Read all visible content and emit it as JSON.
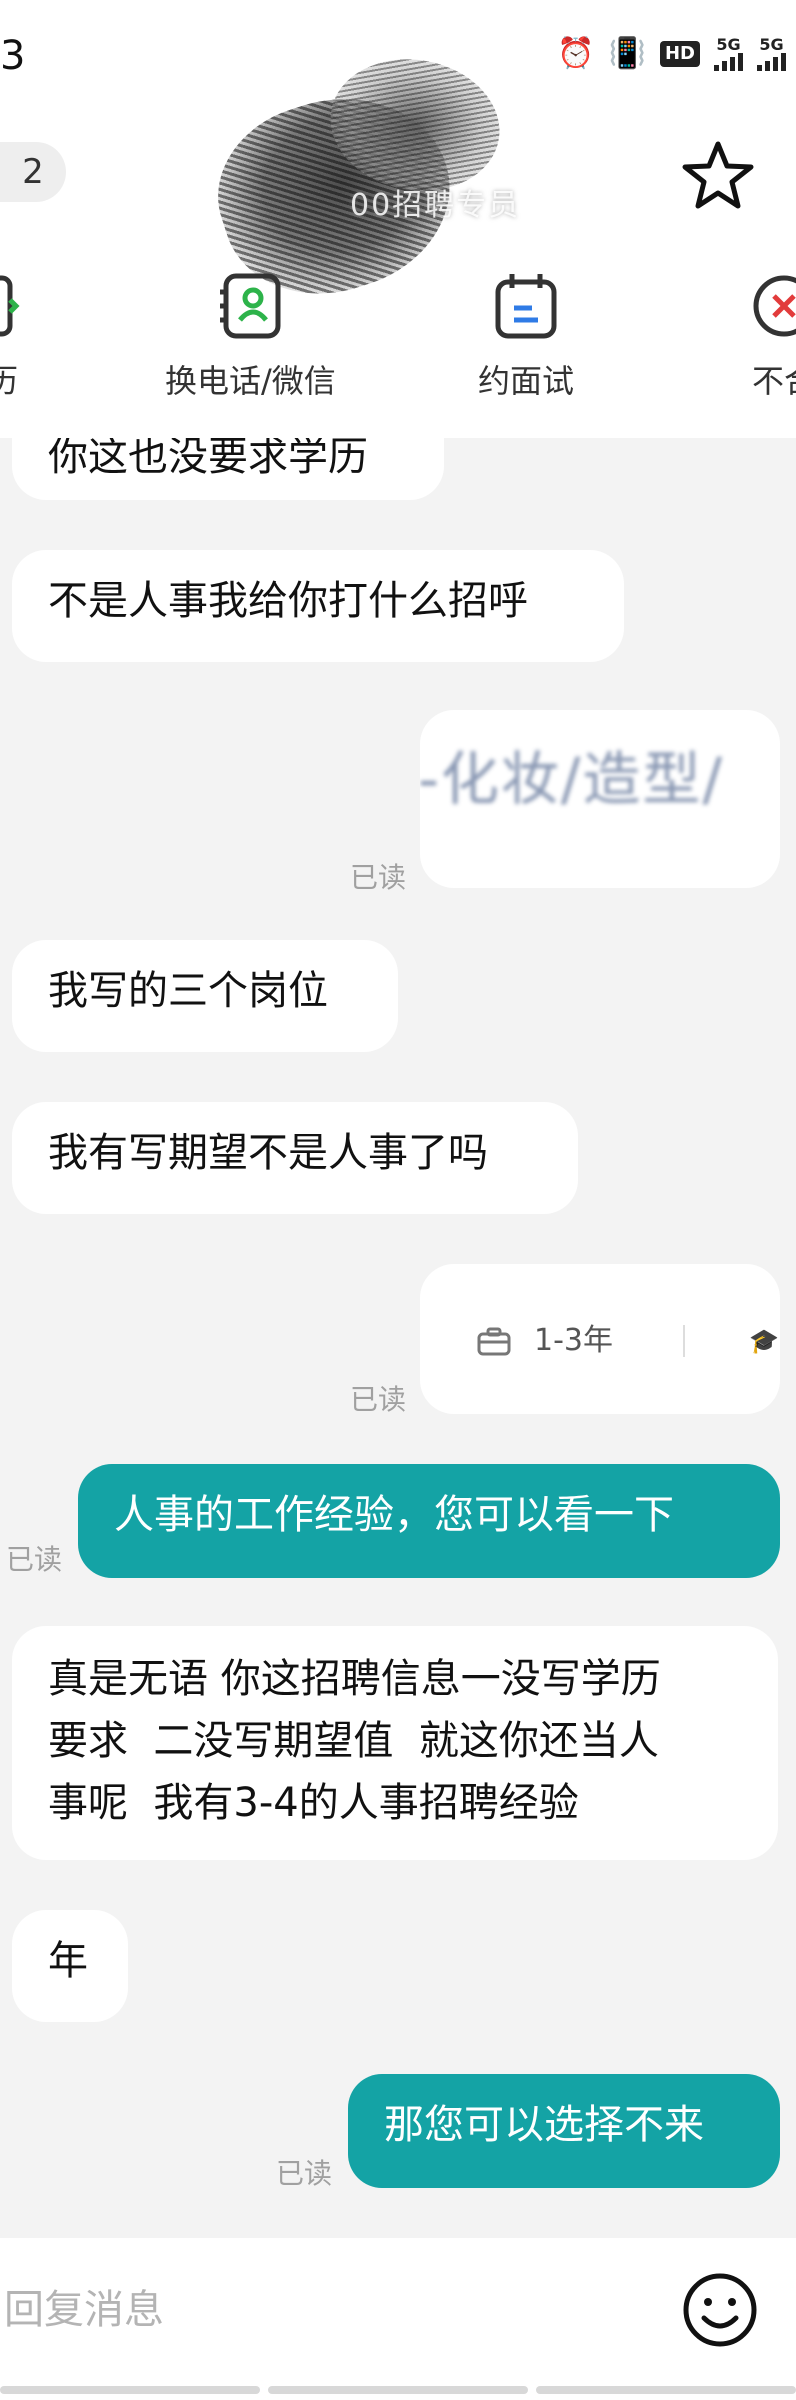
{
  "status_bar": {
    "time_fragment": "3",
    "network_1": "5G",
    "network_2": "5G",
    "hd_label": "HD"
  },
  "header": {
    "unread_count": "2",
    "title": "00招聘专员"
  },
  "actions": [
    {
      "label": "简历"
    },
    {
      "label": "换电话/微信"
    },
    {
      "label": "约面试"
    },
    {
      "label": "不合"
    }
  ],
  "messages": [
    {
      "side": "left",
      "text": "你这也没要求学历"
    },
    {
      "side": "left",
      "text": "不是人事我给你打什么招呼"
    },
    {
      "side": "right_card",
      "text": "-化妆/造型/",
      "read": "已读"
    },
    {
      "side": "left",
      "text": "我写的三个岗位"
    },
    {
      "side": "left",
      "text": "我有写期望不是人事了吗"
    },
    {
      "side": "right_card",
      "text": "1-3年",
      "read": "已读"
    },
    {
      "side": "right",
      "text": "人事的工作经验，您可以看一下",
      "read": "已读"
    },
    {
      "side": "left",
      "lines": [
        "真是无语 你这招聘信息一没写学历",
        "要求  二没写期望值  就这你还当人",
        "事呢  我有3-4的人事招聘经验"
      ]
    },
    {
      "side": "left",
      "text": "年"
    },
    {
      "side": "right",
      "text": "那您可以选择不来",
      "read": "已读"
    }
  ],
  "input": {
    "placeholder": "回复消息"
  },
  "colors": {
    "accent": "#14a3a5",
    "background": "#f3f3f3",
    "bubble_left": "#ffffff",
    "read_text": "#a0a0a0",
    "contact_icon_green": "#2db34a",
    "calendar_icon_blue": "#2f7be6",
    "reject_icon_red": "#e23b3b"
  }
}
